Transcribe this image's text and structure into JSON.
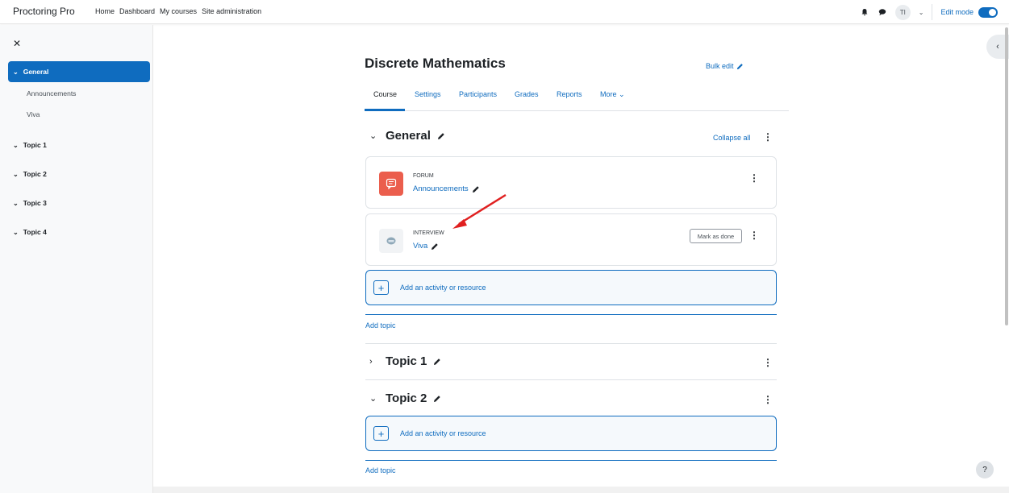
{
  "navbar": {
    "brand": "Proctoring Pro",
    "links": [
      "Home",
      "Dashboard",
      "My courses",
      "Site administration"
    ],
    "avatar_initials": "TI",
    "edit_mode_label": "Edit mode"
  },
  "drawer": {
    "items": [
      {
        "label": "General",
        "active": true
      },
      {
        "label": "Announcements",
        "sub": true
      },
      {
        "label": "Viva",
        "sub": true
      },
      {
        "label": "Topic 1"
      },
      {
        "label": "Topic 2"
      },
      {
        "label": "Topic 3"
      },
      {
        "label": "Topic 4"
      }
    ]
  },
  "course": {
    "title": "Discrete Mathematics",
    "bulk_edit": "Bulk edit",
    "tabs": [
      "Course",
      "Settings",
      "Participants",
      "Grades",
      "Reports",
      "More"
    ]
  },
  "sections": {
    "general": {
      "title": "General",
      "collapse_all": "Collapse all",
      "activities": [
        {
          "type": "FORUM",
          "name": "Announcements"
        },
        {
          "type": "INTERVIEW",
          "name": "Viva",
          "mark_done": "Mark as done"
        }
      ],
      "add_activity": "Add an activity or resource",
      "add_topic": "Add topic"
    },
    "topic1": {
      "title": "Topic 1"
    },
    "topic2": {
      "title": "Topic 2",
      "add_activity": "Add an activity or resource",
      "add_topic": "Add topic"
    }
  },
  "help_label": "?",
  "colors": {
    "accent": "#0f6cbf",
    "forum": "#eb5e4d",
    "arrow": "#e02020"
  }
}
